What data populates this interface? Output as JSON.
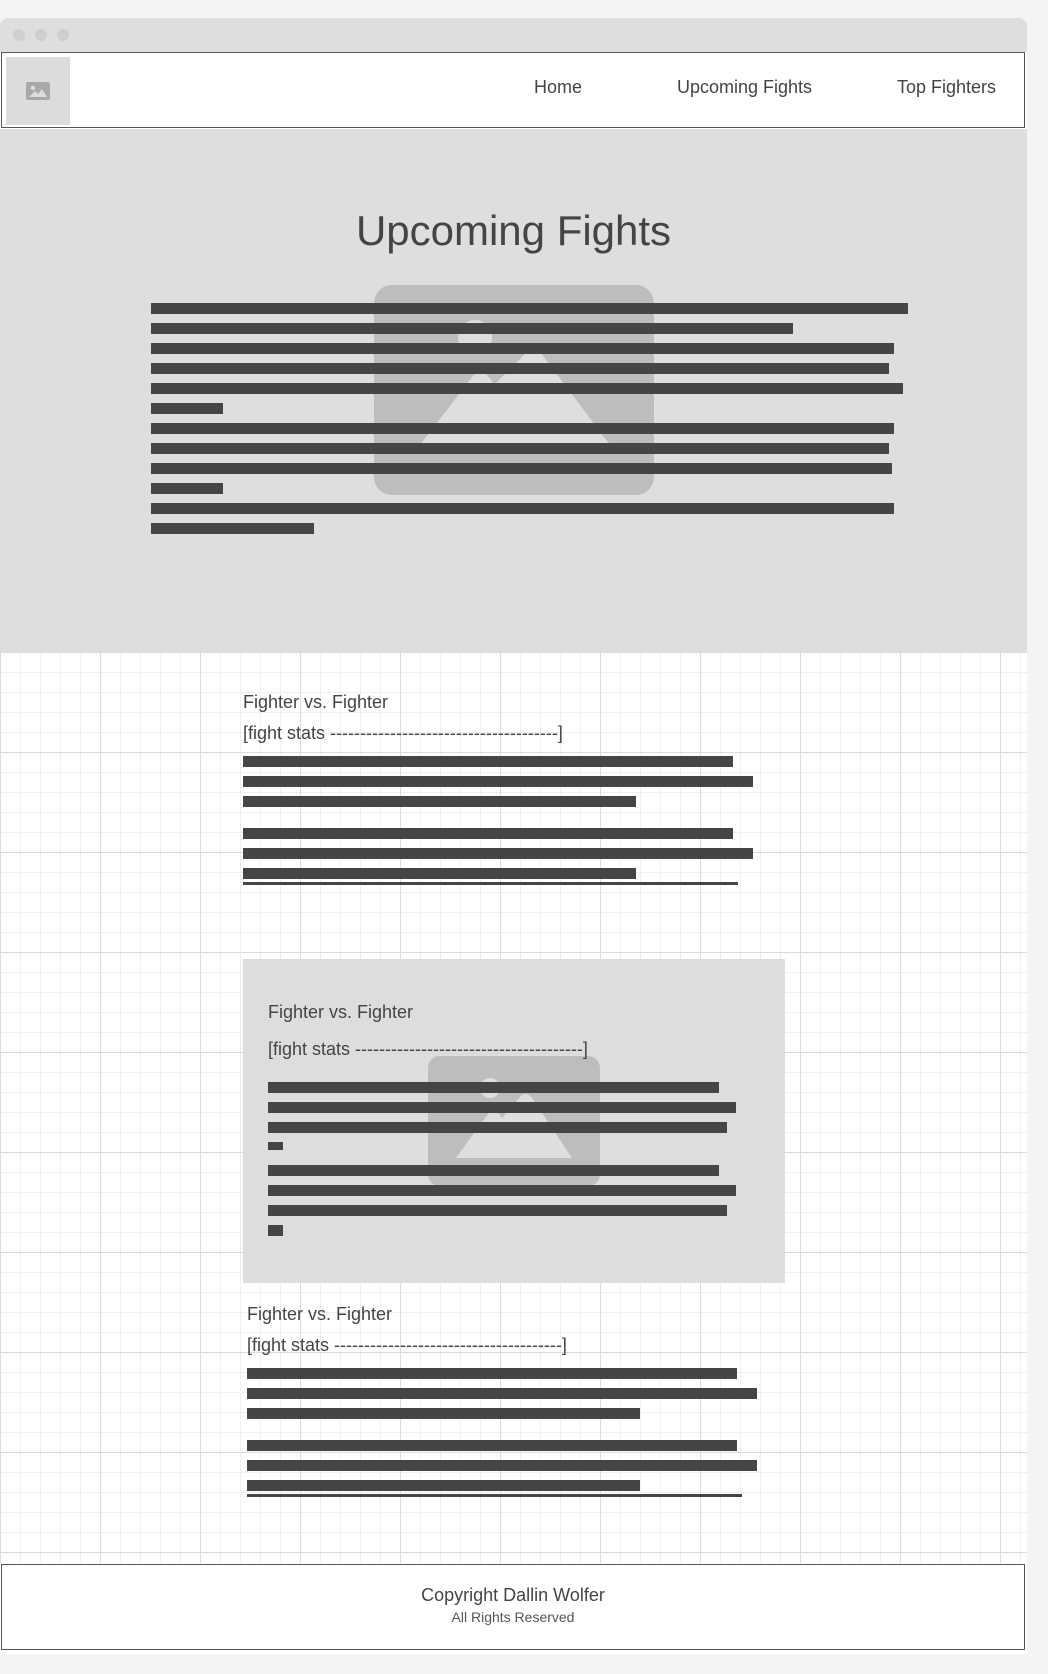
{
  "nav": {
    "logo_icon": "image-icon",
    "links": [
      "Home",
      "Upcoming Fights",
      "Top Fighters"
    ]
  },
  "hero": {
    "title": "Upcoming Fights",
    "image_icon": "image-placeholder-icon"
  },
  "fights": [
    {
      "title": "Fighter vs. Fighter",
      "stats": "[fight stats --------------------------------------]"
    },
    {
      "title": "Fighter vs. Fighter",
      "stats": "[fight stats --------------------------------------]"
    },
    {
      "title": "Fighter vs. Fighter",
      "stats": "[fight stats --------------------------------------]"
    }
  ],
  "footer": {
    "copyright": "Copyright Dallin Wolfer",
    "rights": "All Rights Reserved"
  }
}
